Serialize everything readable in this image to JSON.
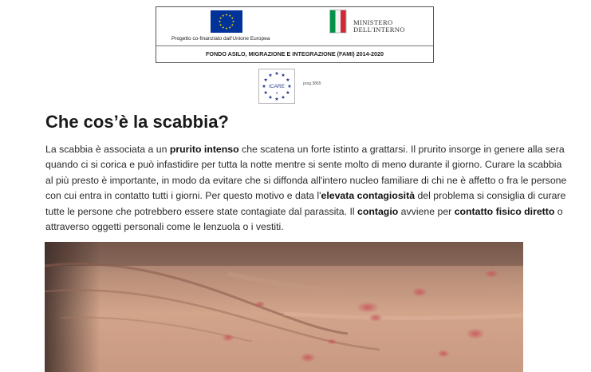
{
  "banner": {
    "eu_caption": "Progetto co-finanziato dall'Unione Europea",
    "ministry_line1": "MINISTERO",
    "ministry_line2": "DELL'INTERNO",
    "fund": "FONDO ASILO, MIGRAZIONE E INTEGRAZIONE (FAMI) 2014-2020"
  },
  "project_logo": {
    "name": "ICARE",
    "number": "3",
    "prog": "prog.3865"
  },
  "article": {
    "title": "Che cos’è la scabbia?",
    "lines": [
      [
        {
          "t": "La scabbia è associata a un "
        },
        {
          "t": "prurito intenso",
          "b": true
        },
        {
          "t": " che scatena un forte istinto a grattarsi. Il prurito insorge in genere alla sera"
        }
      ],
      [
        {
          "t": "quando ci si corica e può infastidire per tutta la notte mentre si sente molto di meno durante il giorno. Curare la scabbia"
        }
      ],
      [
        {
          "t": "al più presto è importante, in modo da evitare che si diffonda all'intero nucleo familiare di chi ne è affetto o fra le persone"
        }
      ],
      [
        {
          "t": "con cui entra in contatto tutti i giorni. Per questo motivo e data l'"
        },
        {
          "t": "elevata contagiosità",
          "b": true
        },
        {
          "t": " del problema si consiglia di curare"
        }
      ],
      [
        {
          "t": "tutte le persone che potrebbero essere state contagiate dal parassita. Il "
        },
        {
          "t": "contagio",
          "b": true
        },
        {
          "t": " avviene per "
        },
        {
          "t": "contatto fisico diretto",
          "b": true
        },
        {
          "t": " o"
        }
      ],
      [
        {
          "t": "attraverso oggetti personali come le lenzuola o i vestiti."
        }
      ]
    ]
  },
  "colors": {
    "eu_blue": "#003399",
    "eu_star": "#ffcc00",
    "italy_green": "#009246",
    "italy_red": "#ce2b37",
    "logo_blue": "#2b3f8f",
    "skin": "#c48a6e"
  },
  "icons": {
    "eu_flag": "eu-flag-icon",
    "emblem": "italian-republic-emblem-icon",
    "project_logo": "icare-star-circle-logo"
  }
}
